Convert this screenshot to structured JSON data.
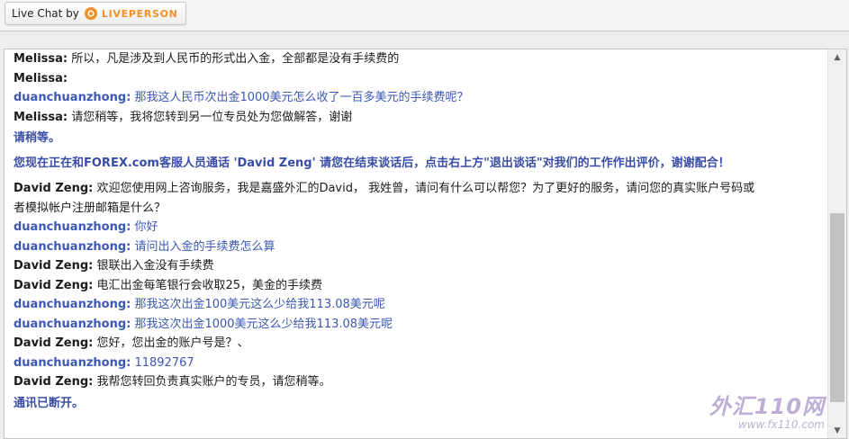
{
  "brand": {
    "prefix": "Live Chat by",
    "logo_icon": "liveperson-logo-icon",
    "name": "LIVEPERSON",
    "accent_color": "#f0902a"
  },
  "messages": [
    {
      "kind": "agent",
      "sender": "Melissa:",
      "text": " 所以，凡是涉及到人民币的形式出入金，全部都是没有手续费的"
    },
    {
      "kind": "agent",
      "sender": "Melissa:",
      "text": ""
    },
    {
      "kind": "visitor",
      "sender": "duanchuanzhong:",
      "text": " 那我这人民币次出金1000美元怎么收了一百多美元的手续费呢？"
    },
    {
      "kind": "agent",
      "sender": "Melissa:",
      "text": " 请您稍等，我将您转到另一位专员处为您做解答，谢谢"
    },
    {
      "kind": "system",
      "text": "请稍等。"
    },
    {
      "kind": "system",
      "text": "您现在正在和FOREX.com客服人员通话 'David Zeng' 请您在结束谈话后，点击右上方\"退出谈话\"对我们的工作作出评价，谢谢配合！"
    },
    {
      "kind": "agent",
      "sender": "David Zeng:",
      "text": " 欢迎您使用网上咨询服务，我是嘉盛外汇的David， 我姓曾，请问有什么可以帮您？为了更好的服务，请问您的真实账户号码或者模拟帐户注册邮箱是什么？"
    },
    {
      "kind": "visitor",
      "sender": "duanchuanzhong:",
      "text": " 你好"
    },
    {
      "kind": "visitor",
      "sender": "duanchuanzhong:",
      "text": " 请问出入金的手续费怎么算"
    },
    {
      "kind": "agent",
      "sender": "David Zeng:",
      "text": " 银联出入金没有手续费"
    },
    {
      "kind": "agent",
      "sender": "David Zeng:",
      "text": " 电汇出金每笔银行会收取25，美金的手续费"
    },
    {
      "kind": "visitor",
      "sender": "duanchuanzhong:",
      "text": " 那我这次出金100美元这么少给我113.08美元呢"
    },
    {
      "kind": "visitor",
      "sender": "duanchuanzhong:",
      "text": " 那我这次出金1000美元这么少给我113.08美元呢"
    },
    {
      "kind": "agent",
      "sender": "David Zeng:",
      "text": " 您好，您出金的账户号是？、"
    },
    {
      "kind": "visitor",
      "sender": "duanchuanzhong:",
      "text": " 11892767"
    },
    {
      "kind": "agent",
      "sender": "David Zeng:",
      "text": " 我帮您转回负责真实账户的专员，请您稍等。"
    },
    {
      "kind": "system",
      "text": "通讯已断开。"
    }
  ],
  "scrollbar": {
    "up_icon": "scroll-up-arrow-icon",
    "down_icon": "scroll-down-arrow-icon"
  },
  "watermark": {
    "logo": "外汇110网",
    "url": "www.fx110.com"
  }
}
